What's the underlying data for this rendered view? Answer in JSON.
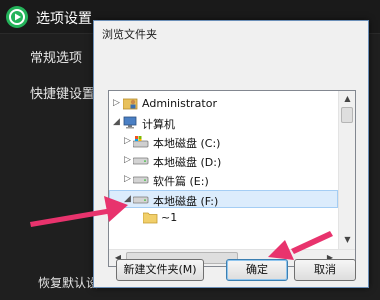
{
  "background_window": {
    "title": "选项设置",
    "menu": [
      "常规选项",
      "快捷键设置"
    ],
    "restore_button_label": "恢复默认设置"
  },
  "dialog": {
    "title": "浏览文件夹",
    "tree": [
      {
        "label": "Administrator",
        "icon": "user-folder-icon",
        "expander": "collapsed",
        "level": 0
      },
      {
        "label": "计算机",
        "icon": "computer-icon",
        "expander": "expanded",
        "level": 0
      },
      {
        "label": "本地磁盘 (C:)",
        "icon": "system-drive-icon",
        "expander": "collapsed",
        "level": 1
      },
      {
        "label": "本地磁盘 (D:)",
        "icon": "hard-drive-icon",
        "expander": "collapsed",
        "level": 1
      },
      {
        "label": "软件篇 (E:)",
        "icon": "hard-drive-icon",
        "expander": "collapsed",
        "level": 1
      },
      {
        "label": "本地磁盘 (F:)",
        "icon": "hard-drive-icon",
        "expander": "expanded",
        "level": 1,
        "selected": true
      },
      {
        "label": "~1",
        "icon": "folder-icon",
        "expander": "none",
        "level": 2
      }
    ],
    "buttons": {
      "new_folder": "新建文件夹(M)",
      "ok": "确定",
      "cancel": "取消"
    }
  },
  "colors": {
    "annotation_arrow": "#e8336d",
    "app_logo": "#24b35a",
    "selection": "#dcecfc"
  }
}
